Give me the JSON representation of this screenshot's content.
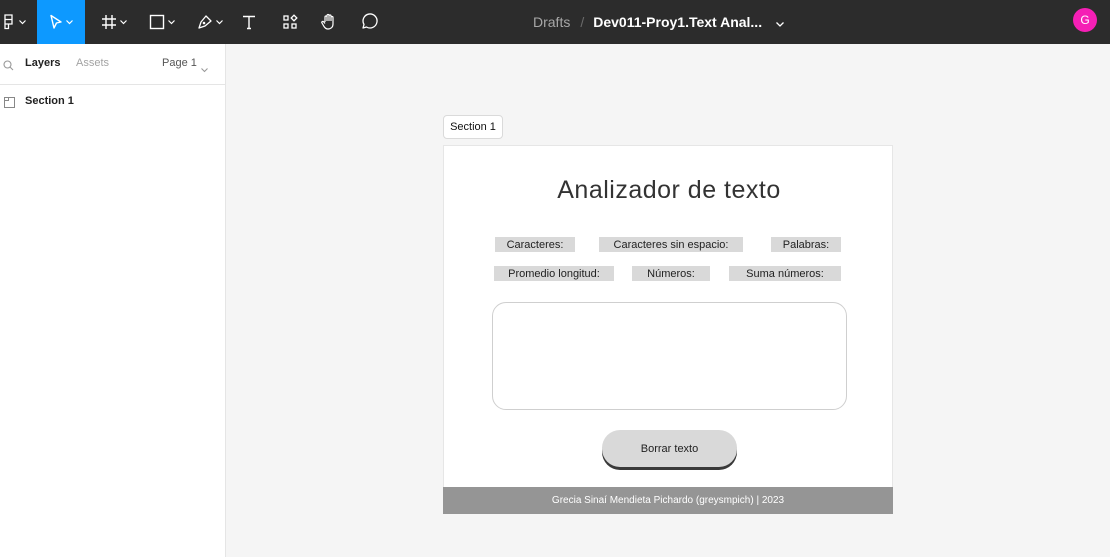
{
  "toolbar": {
    "tools": [
      {
        "name": "main-menu",
        "icon": "figma-logo-icon"
      },
      {
        "name": "move-tool",
        "icon": "cursor-arrow-icon",
        "active": true
      },
      {
        "name": "frame-tool",
        "icon": "frame-hash-icon"
      },
      {
        "name": "shape-tool",
        "icon": "rectangle-icon"
      },
      {
        "name": "pen-tool",
        "icon": "pen-nib-icon"
      },
      {
        "name": "text-tool",
        "icon": "text-T-icon"
      },
      {
        "name": "resources-tool",
        "icon": "components-grid-icon"
      },
      {
        "name": "hand-tool",
        "icon": "hand-icon"
      },
      {
        "name": "comment-tool",
        "icon": "comment-bubble-icon"
      }
    ],
    "breadcrumb": {
      "project": "Drafts",
      "separator": "/",
      "file": "Dev011-Proy1.Text Anal..."
    },
    "avatar_initial": "G",
    "accent": "#0d99ff",
    "avatar_color": "#f51fb5"
  },
  "panel": {
    "tabs": {
      "layers": "Layers",
      "assets": "Assets"
    },
    "page_selector": "Page 1",
    "layers": [
      {
        "name": "Section 1"
      }
    ]
  },
  "canvas": {
    "section_label": "Section 1",
    "frame": {
      "title": "Analizador de texto",
      "stats_row1": [
        "Caracteres:",
        "Caracteres sin espacio:",
        "Palabras:"
      ],
      "stats_row2": [
        "Promedio longitud:",
        "Números:",
        "Suma números:"
      ],
      "textarea_value": "",
      "button_label": "Borrar texto",
      "footer": "Grecia Sinaí Mendieta Pichardo (greysmpich) |  2023"
    }
  }
}
